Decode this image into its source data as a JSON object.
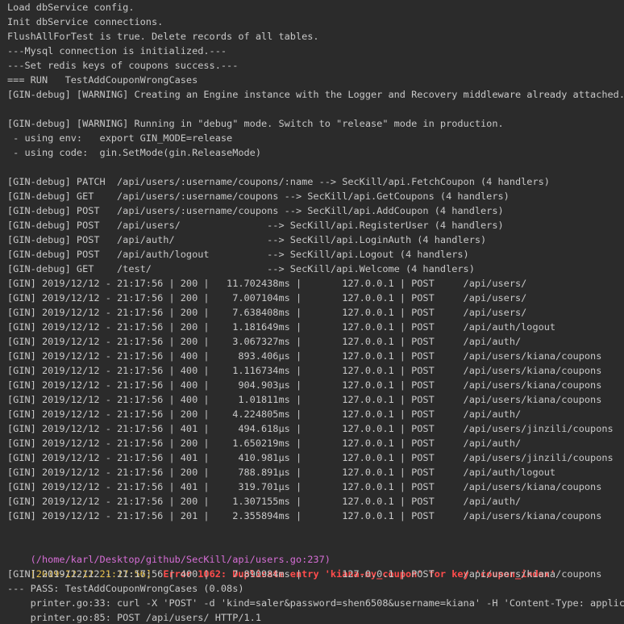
{
  "colors": {
    "background": "#2b2b2b",
    "text": "#c8c8c8",
    "path": "#d66ed6",
    "timestamp": "#e8c14c",
    "error": "#ff4c4c"
  },
  "lines": [
    "Load dbService config.",
    "Init dbService connections.",
    "FlushAllForTest is true. Delete records of all tables.",
    "---Mysql connection is initialized.---",
    "---Set redis keys of coupons success.---",
    "=== RUN   TestAddCouponWrongCases",
    "[GIN-debug] [WARNING] Creating an Engine instance with the Logger and Recovery middleware already attached.",
    "",
    "[GIN-debug] [WARNING] Running in \"debug\" mode. Switch to \"release\" mode in production.",
    " - using env:   export GIN_MODE=release",
    " - using code:  gin.SetMode(gin.ReleaseMode)",
    "",
    "[GIN-debug] PATCH  /api/users/:username/coupons/:name --> SecKill/api.FetchCoupon (4 handlers)",
    "[GIN-debug] GET    /api/users/:username/coupons --> SecKill/api.GetCoupons (4 handlers)",
    "[GIN-debug] POST   /api/users/:username/coupons --> SecKill/api.AddCoupon (4 handlers)",
    "[GIN-debug] POST   /api/users/               --> SecKill/api.RegisterUser (4 handlers)",
    "[GIN-debug] POST   /api/auth/                --> SecKill/api.LoginAuth (4 handlers)",
    "[GIN-debug] POST   /api/auth/logout          --> SecKill/api.Logout (4 handlers)",
    "[GIN-debug] GET    /test/                    --> SecKill/api.Welcome (4 handlers)",
    "[GIN] 2019/12/12 - 21:17:56 | 200 |   11.702438ms |       127.0.0.1 | POST     /api/users/",
    "[GIN] 2019/12/12 - 21:17:56 | 200 |    7.007104ms |       127.0.0.1 | POST     /api/users/",
    "[GIN] 2019/12/12 - 21:17:56 | 200 |    7.638408ms |       127.0.0.1 | POST     /api/users/",
    "[GIN] 2019/12/12 - 21:17:56 | 200 |    1.181649ms |       127.0.0.1 | POST     /api/auth/logout",
    "[GIN] 2019/12/12 - 21:17:56 | 200 |    3.067327ms |       127.0.0.1 | POST     /api/auth/",
    "[GIN] 2019/12/12 - 21:17:56 | 400 |     893.406µs |       127.0.0.1 | POST     /api/users/kiana/coupons",
    "[GIN] 2019/12/12 - 21:17:56 | 400 |    1.116734ms |       127.0.0.1 | POST     /api/users/kiana/coupons",
    "[GIN] 2019/12/12 - 21:17:56 | 400 |     904.903µs |       127.0.0.1 | POST     /api/users/kiana/coupons",
    "[GIN] 2019/12/12 - 21:17:56 | 400 |     1.01811ms |       127.0.0.1 | POST     /api/users/kiana/coupons",
    "[GIN] 2019/12/12 - 21:17:56 | 200 |    4.224805ms |       127.0.0.1 | POST     /api/auth/",
    "[GIN] 2019/12/12 - 21:17:56 | 401 |     494.618µs |       127.0.0.1 | POST     /api/users/jinzili/coupons",
    "[GIN] 2019/12/12 - 21:17:56 | 200 |    1.650219ms |       127.0.0.1 | POST     /api/auth/",
    "[GIN] 2019/12/12 - 21:17:56 | 401 |     410.981µs |       127.0.0.1 | POST     /api/users/jinzili/coupons",
    "[GIN] 2019/12/12 - 21:17:56 | 200 |     788.891µs |       127.0.0.1 | POST     /api/auth/logout",
    "[GIN] 2019/12/12 - 21:17:56 | 401 |     319.701µs |       127.0.0.1 | POST     /api/users/kiana/coupons",
    "[GIN] 2019/12/12 - 21:17:56 | 200 |    1.307155ms |       127.0.0.1 | POST     /api/auth/",
    "[GIN] 2019/12/12 - 21:17:56 | 201 |    2.355894ms |       127.0.0.1 | POST     /api/users/kiana/coupons",
    ""
  ],
  "error_block": {
    "path": "(/home/karl/Desktop/github/SecKill/api/users.go:237)",
    "timestamp": "[2019-12-12 21:17:56]",
    "message": "Error 1062: Duplicate entry 'kiana-my_coupon' for key 'coupon_index'"
  },
  "tail_lines": [
    "[GIN] 2019/12/12 - 21:17:56 | 400 |    7.890984ms |       127.0.0.1 | POST     /api/users/kiana/coupons",
    "--- PASS: TestAddCouponWrongCases (0.08s)",
    "    printer.go:33: curl -X 'POST' -d 'kind=saler&password=shen6508&username=kiana' -H 'Content-Type: applicati",
    "    printer.go:85: POST /api/users/ HTTP/1.1"
  ]
}
